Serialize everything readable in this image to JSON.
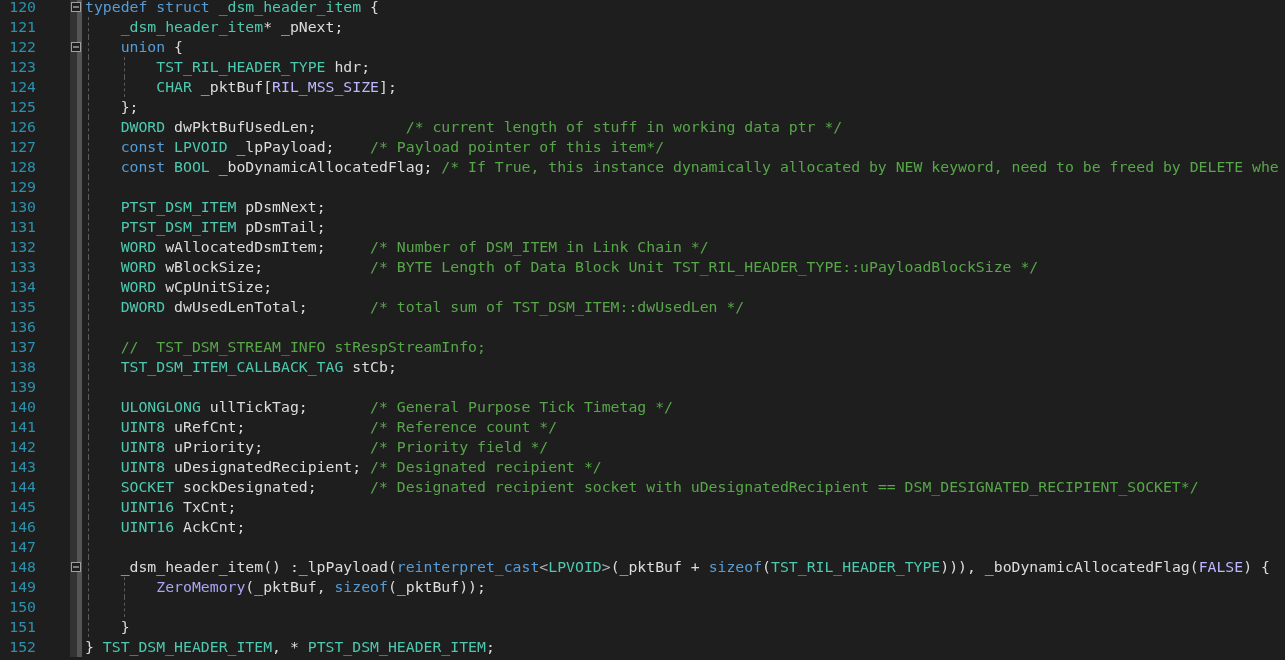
{
  "editor": {
    "lines": [
      {
        "number": "120",
        "fold": {
          "expanded": true
        },
        "tokens": [
          {
            "kind": "keyword",
            "text": "typedef"
          },
          {
            "kind": "keyword",
            "text": " struct"
          },
          {
            "kind": "type",
            "text": " _dsm_header_item"
          },
          {
            "kind": "plain",
            "text": " {"
          }
        ]
      },
      {
        "number": "121",
        "tokens": [
          {
            "kind": "type",
            "text": "    _dsm_header_item"
          },
          {
            "kind": "plain",
            "text": "* _pNext;"
          }
        ]
      },
      {
        "number": "122",
        "fold": {
          "expanded": true
        },
        "tokens": [
          {
            "kind": "keyword",
            "text": "    union"
          },
          {
            "kind": "plain",
            "text": " {"
          }
        ]
      },
      {
        "number": "123",
        "tokens": [
          {
            "kind": "type",
            "text": "        TST_RIL_HEADER_TYPE"
          },
          {
            "kind": "plain",
            "text": " hdr;"
          }
        ]
      },
      {
        "number": "124",
        "tokens": [
          {
            "kind": "type",
            "text": "        CHAR"
          },
          {
            "kind": "plain",
            "text": " _pktBuf["
          },
          {
            "kind": "macro",
            "text": "RIL_MSS_SIZE"
          },
          {
            "kind": "plain",
            "text": "];"
          }
        ]
      },
      {
        "number": "125",
        "tokens": [
          {
            "kind": "plain",
            "text": "    };"
          }
        ]
      },
      {
        "number": "126",
        "tokens": [
          {
            "kind": "type",
            "text": "    DWORD"
          },
          {
            "kind": "plain",
            "text": " dwPktBufUsedLen;          "
          },
          {
            "kind": "comment",
            "text": "/* current length of stuff in working data ptr */"
          }
        ]
      },
      {
        "number": "127",
        "tokens": [
          {
            "kind": "keyword",
            "text": "    const"
          },
          {
            "kind": "type",
            "text": " LPVOID"
          },
          {
            "kind": "plain",
            "text": " _lpPayload;    "
          },
          {
            "kind": "comment",
            "text": "/* Payload pointer of this item*/"
          }
        ]
      },
      {
        "number": "128",
        "tokens": [
          {
            "kind": "keyword",
            "text": "    const"
          },
          {
            "kind": "type",
            "text": " BOOL"
          },
          {
            "kind": "plain",
            "text": " _boDynamicAllocatedFlag; "
          },
          {
            "kind": "comment",
            "text": "/* If True, this instance dynamically allocated by NEW keyword, need to be freed by DELETE whe"
          }
        ]
      },
      {
        "number": "129"
      },
      {
        "number": "130",
        "tokens": [
          {
            "kind": "type",
            "text": "    PTST_DSM_ITEM"
          },
          {
            "kind": "plain",
            "text": " pDsmNext;"
          }
        ]
      },
      {
        "number": "131",
        "tokens": [
          {
            "kind": "type",
            "text": "    PTST_DSM_ITEM"
          },
          {
            "kind": "plain",
            "text": " pDsmTail;"
          }
        ]
      },
      {
        "number": "132",
        "tokens": [
          {
            "kind": "type",
            "text": "    WORD"
          },
          {
            "kind": "plain",
            "text": " wAllocatedDsmItem;     "
          },
          {
            "kind": "comment",
            "text": "/* Number of DSM_ITEM in Link Chain */"
          }
        ]
      },
      {
        "number": "133",
        "tokens": [
          {
            "kind": "type",
            "text": "    WORD"
          },
          {
            "kind": "plain",
            "text": " wBlockSize;            "
          },
          {
            "kind": "comment",
            "text": "/* BYTE Length of Data Block Unit TST_RIL_HEADER_TYPE::uPayloadBlockSize */"
          }
        ]
      },
      {
        "number": "134",
        "tokens": [
          {
            "kind": "type",
            "text": "    WORD"
          },
          {
            "kind": "plain",
            "text": " wCpUnitSize;"
          }
        ]
      },
      {
        "number": "135",
        "tokens": [
          {
            "kind": "type",
            "text": "    DWORD"
          },
          {
            "kind": "plain",
            "text": " dwUsedLenTotal;       "
          },
          {
            "kind": "comment",
            "text": "/* total sum of TST_DSM_ITEM::dwUsedLen */"
          }
        ]
      },
      {
        "number": "136"
      },
      {
        "number": "137",
        "tokens": [
          {
            "kind": "comment",
            "text": "    //  TST_DSM_STREAM_INFO stRespStreamInfo;"
          }
        ]
      },
      {
        "number": "138",
        "tokens": [
          {
            "kind": "type",
            "text": "    TST_DSM_ITEM_CALLBACK_TAG"
          },
          {
            "kind": "plain",
            "text": " stCb;"
          }
        ]
      },
      {
        "number": "139"
      },
      {
        "number": "140",
        "tokens": [
          {
            "kind": "type",
            "text": "    ULONGLONG"
          },
          {
            "kind": "plain",
            "text": " ullTickTag;       "
          },
          {
            "kind": "comment",
            "text": "/* General Purpose Tick Timetag */"
          }
        ]
      },
      {
        "number": "141",
        "tokens": [
          {
            "kind": "type",
            "text": "    UINT8"
          },
          {
            "kind": "plain",
            "text": " uRefCnt;              "
          },
          {
            "kind": "comment",
            "text": "/* Reference count */"
          }
        ]
      },
      {
        "number": "142",
        "tokens": [
          {
            "kind": "type",
            "text": "    UINT8"
          },
          {
            "kind": "plain",
            "text": " uPriority;            "
          },
          {
            "kind": "comment",
            "text": "/* Priority field */"
          }
        ]
      },
      {
        "number": "143",
        "tokens": [
          {
            "kind": "type",
            "text": "    UINT8"
          },
          {
            "kind": "plain",
            "text": " uDesignatedRecipient; "
          },
          {
            "kind": "comment",
            "text": "/* Designated recipient */"
          }
        ]
      },
      {
        "number": "144",
        "tokens": [
          {
            "kind": "type",
            "text": "    SOCKET"
          },
          {
            "kind": "plain",
            "text": " sockDesignated;      "
          },
          {
            "kind": "comment",
            "text": "/* Designated recipient socket with uDesignatedRecipient == DSM_DESIGNATED_RECIPIENT_SOCKET*/"
          }
        ]
      },
      {
        "number": "145",
        "tokens": [
          {
            "kind": "type",
            "text": "    UINT16"
          },
          {
            "kind": "plain",
            "text": " TxCnt;"
          }
        ]
      },
      {
        "number": "146",
        "tokens": [
          {
            "kind": "type",
            "text": "    UINT16"
          },
          {
            "kind": "plain",
            "text": " AckCnt;"
          }
        ]
      },
      {
        "number": "147"
      },
      {
        "number": "148",
        "fold": {
          "expanded": true
        },
        "tokens": [
          {
            "kind": "plain",
            "text": "    _dsm_header_item() :_lpPayload("
          },
          {
            "kind": "keyword",
            "text": "reinterpret_cast"
          },
          {
            "kind": "punct",
            "text": "<"
          },
          {
            "kind": "type",
            "text": "LPVOID"
          },
          {
            "kind": "punct",
            "text": ">"
          },
          {
            "kind": "plain",
            "text": "(_pktBuf + "
          },
          {
            "kind": "keyword",
            "text": "sizeof"
          },
          {
            "kind": "plain",
            "text": "("
          },
          {
            "kind": "type",
            "text": "TST_RIL_HEADER_TYPE"
          },
          {
            "kind": "plain",
            "text": "))), _boDynamicAllocatedFlag("
          },
          {
            "kind": "macro",
            "text": "FALSE"
          },
          {
            "kind": "plain",
            "text": ") {"
          }
        ]
      },
      {
        "number": "149",
        "tokens": [
          {
            "kind": "function",
            "text": "        ZeroMemory"
          },
          {
            "kind": "plain",
            "text": "(_pktBuf, "
          },
          {
            "kind": "keyword",
            "text": "sizeof"
          },
          {
            "kind": "plain",
            "text": "(_pktBuf));"
          }
        ]
      },
      {
        "number": "150"
      },
      {
        "number": "151",
        "tokens": [
          {
            "kind": "plain",
            "text": "    }"
          }
        ]
      },
      {
        "number": "152",
        "tokens": [
          {
            "kind": "plain",
            "text": "} "
          },
          {
            "kind": "type",
            "text": "TST_DSM_HEADER_ITEM"
          },
          {
            "kind": "plain",
            "text": ", * "
          },
          {
            "kind": "type",
            "text": "PTST_DSM_HEADER_ITEM"
          },
          {
            "kind": "plain",
            "text": ";"
          }
        ]
      }
    ]
  }
}
